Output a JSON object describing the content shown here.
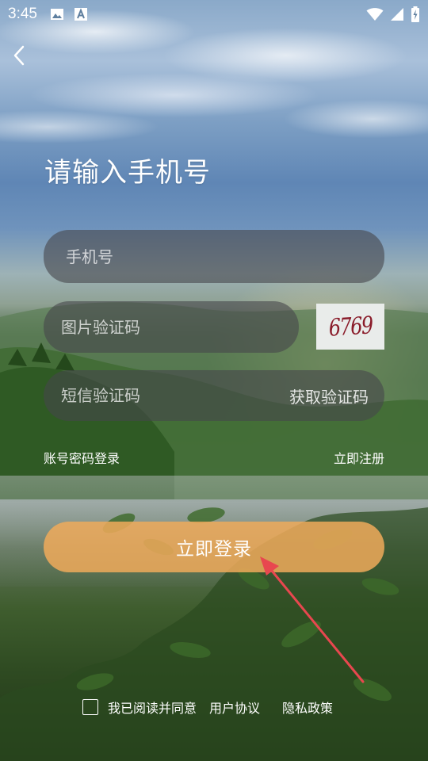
{
  "status_bar": {
    "time": "3:45",
    "left_icons": [
      "image-icon",
      "font-a-icon"
    ],
    "right_icons": [
      "wifi-icon",
      "signal-icon",
      "battery-charging-icon"
    ]
  },
  "nav": {
    "back_icon": "chevron-left-icon"
  },
  "page": {
    "title": "请输入手机号"
  },
  "form": {
    "phone_placeholder": "手机号",
    "captcha_placeholder": "图片验证码",
    "captcha_image_text": "6769",
    "sms_placeholder": "短信验证码",
    "get_code_label": "获取验证码"
  },
  "links": {
    "password_login": "账号密码登录",
    "register": "立即注册"
  },
  "login_button": {
    "label": "立即登录",
    "color": "#F0AA5A"
  },
  "agreement": {
    "checked": false,
    "text": "我已阅读并同意",
    "user_agreement": "用户协议",
    "privacy_policy": "隐私政策"
  },
  "annotation": {
    "arrow_color": "#E8474F"
  }
}
